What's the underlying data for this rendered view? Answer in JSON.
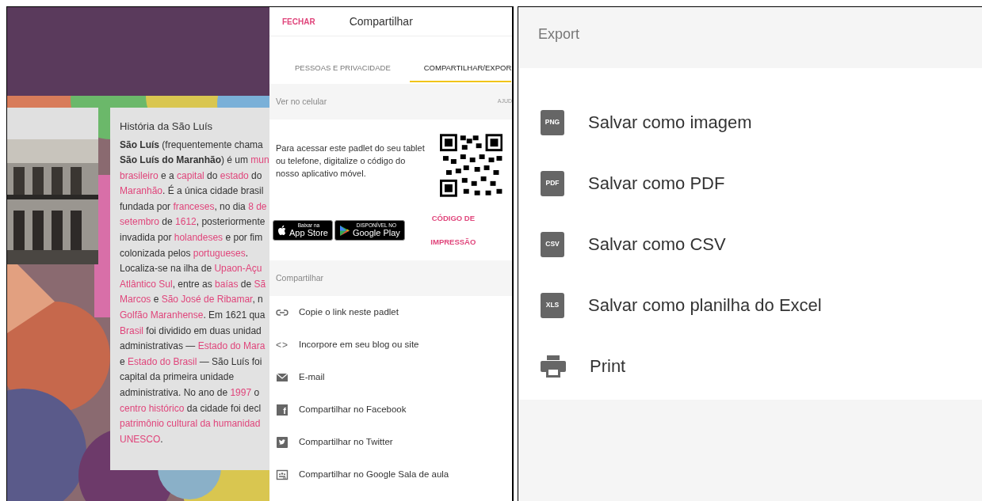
{
  "board": {
    "article": {
      "title": "História da São Luís",
      "lines": [
        [
          {
            "t": "São Luís",
            "bold": true
          },
          {
            "t": " (frequentemente chama"
          }
        ],
        [
          {
            "t": "São Luís do Maranhão",
            "bold": true
          },
          {
            "t": ") é um "
          },
          {
            "t": "mun",
            "link": true
          }
        ],
        [
          {
            "t": "brasileiro",
            "link": true
          },
          {
            "t": " e a "
          },
          {
            "t": "capital",
            "link": true
          },
          {
            "t": " do "
          },
          {
            "t": "estado",
            "link": true
          },
          {
            "t": " do"
          }
        ],
        [
          {
            "t": "Maranhão",
            "link": true
          },
          {
            "t": ". É a única cidade brasil"
          }
        ],
        [
          {
            "t": "fundada por "
          },
          {
            "t": "franceses",
            "link": true
          },
          {
            "t": ", no dia "
          },
          {
            "t": "8 de",
            "link": true
          }
        ],
        [
          {
            "t": "setembro",
            "link": true
          },
          {
            "t": " de "
          },
          {
            "t": "1612",
            "link": true
          },
          {
            "t": ", posteriormente"
          }
        ],
        [
          {
            "t": "invadida por "
          },
          {
            "t": "holandeses",
            "link": true
          },
          {
            "t": " e por fim"
          }
        ],
        [
          {
            "t": "colonizada pelos "
          },
          {
            "t": "portugueses",
            "link": true
          },
          {
            "t": "."
          }
        ],
        [
          {
            "t": "Localiza-se na ilha de "
          },
          {
            "t": "Upaon-Açu",
            "link": true
          }
        ],
        [
          {
            "t": "Atlântico Sul",
            "link": true
          },
          {
            "t": ", entre as "
          },
          {
            "t": "baías",
            "link": true
          },
          {
            "t": " de "
          },
          {
            "t": "Sã",
            "link": true
          }
        ],
        [
          {
            "t": "Marcos",
            "link": true
          },
          {
            "t": " e "
          },
          {
            "t": "São José de Ribamar",
            "link": true
          },
          {
            "t": ", n"
          }
        ],
        [
          {
            "t": "Golfão Maranhense",
            "link": true
          },
          {
            "t": ". Em 1621 qua"
          }
        ],
        [
          {
            "t": "Brasil",
            "link": true
          },
          {
            "t": " foi dividido em duas unidad"
          }
        ],
        [
          {
            "t": "administrativas — "
          },
          {
            "t": "Estado do Mara",
            "link": true
          }
        ],
        [
          {
            "t": "e "
          },
          {
            "t": "Estado do Brasil",
            "link": true
          },
          {
            "t": " — São Luís foi"
          }
        ],
        [
          {
            "t": "capital da primeira unidade"
          }
        ],
        [
          {
            "t": "administrativa. No ano de "
          },
          {
            "t": "1997",
            "link": true
          },
          {
            "t": " o"
          }
        ],
        [
          {
            "t": "centro histórico",
            "link": true
          },
          {
            "t": " da cidade foi decl"
          }
        ],
        [
          {
            "t": "patrimônio cultural da humanidad",
            "link": true
          }
        ],
        [
          {
            "t": "UNESCO",
            "link": true
          },
          {
            "t": "."
          }
        ]
      ]
    }
  },
  "share_panel": {
    "close": "FECHAR",
    "title": "Compartilhar",
    "tabs": [
      {
        "label": "PESSOAS E PRIVACIDADE",
        "selected": false
      },
      {
        "label": "COMPARTILHAR/EXPOR",
        "selected": true
      }
    ],
    "mobile_section": {
      "title": "Ver no celular",
      "help": "AJUD",
      "text": "Para acessar este padlet do seu tablet ou telefone, digitalize o código do nosso aplicativo móvel.",
      "badges": [
        {
          "kind": "apple",
          "small": "Baixar na",
          "big": "App Store"
        },
        {
          "kind": "google",
          "small": "DISPONÍVEL NO",
          "big": "Google Play"
        }
      ],
      "print_code": "CÓDIGO DE IMPRESSÃO"
    },
    "share_section": {
      "title": "Compartilhar",
      "items": [
        {
          "kind": "link",
          "label": "Copie o link neste padlet"
        },
        {
          "kind": "embed",
          "label": "Incorpore em seu blog ou site",
          "icon_text": "<>"
        },
        {
          "kind": "email",
          "label": "E-mail"
        },
        {
          "kind": "facebook",
          "label": "Compartilhar no Facebook",
          "icon_text": "f"
        },
        {
          "kind": "twitter",
          "label": "Compartilhar no Twitter"
        },
        {
          "kind": "classroom",
          "label": "Compartilhar no Google Sala de aula"
        }
      ]
    }
  },
  "export_panel": {
    "title": "Export",
    "items": [
      {
        "kind": "file",
        "icon_text": "PNG",
        "label": "Salvar como imagem"
      },
      {
        "kind": "file",
        "icon_text": "PDF",
        "label": "Salvar como PDF"
      },
      {
        "kind": "file",
        "icon_text": "CSV",
        "label": "Salvar como CSV"
      },
      {
        "kind": "file",
        "icon_text": "XLS",
        "label": "Salvar como planilha do Excel"
      },
      {
        "kind": "print",
        "label": "Print"
      }
    ]
  }
}
